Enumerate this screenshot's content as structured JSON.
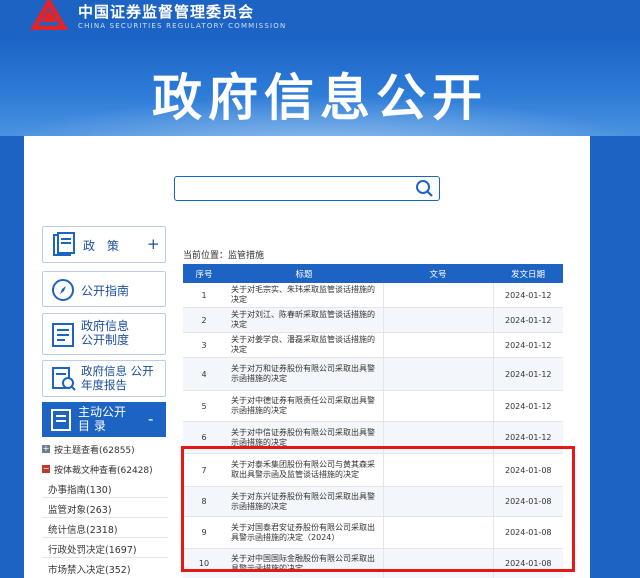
{
  "header": {
    "org_name_cn": "中国证券监督管理委员会",
    "org_name_en": "CHINA SECURITIES REGULATORY COMMISSION",
    "banner_title": "政府信息公开"
  },
  "search": {
    "placeholder": ""
  },
  "sidebar": {
    "buttons": [
      {
        "label": "政  策",
        "suffix": "+"
      },
      {
        "label": "公开指南"
      },
      {
        "label": "政府信息 公开制度"
      },
      {
        "label": "政府信息 公开年度报告"
      }
    ],
    "active": {
      "label": "主动公开 目  录",
      "suffix": "-"
    },
    "tree": [
      {
        "label": "按主题查看(62855)",
        "expanded": false
      },
      {
        "label": "按体裁文种查看(62428)",
        "expanded": true
      }
    ],
    "leaves": [
      "办事指南(130)",
      "监管对象(263)",
      "统计信息(2318)",
      "行政处罚决定(1697)",
      "市场禁入决定(352)"
    ]
  },
  "breadcrumb": "当前位置：监管措施",
  "table": {
    "headers": [
      "序号",
      "标题",
      "文号",
      "发文日期"
    ],
    "rows": [
      {
        "no": "1",
        "title": "关于对毛宗实、朱玮采取监管谈话措施的决定",
        "doc": "",
        "date": "2024-01-12"
      },
      {
        "no": "2",
        "title": "关于对刘江、陈春昕采取监管谈话措施的决定",
        "doc": "",
        "date": "2024-01-12"
      },
      {
        "no": "3",
        "title": "关于对姜学良、潘磊采取监管谈话措施的决定",
        "doc": "",
        "date": "2024-01-12"
      },
      {
        "no": "4",
        "title": "关于对万和证券股份有限公司采取出具警示函措施的决定",
        "doc": "",
        "date": "2024-01-12"
      },
      {
        "no": "5",
        "title": "关于对中德证券有限责任公司采取出具警示函措施的决定",
        "doc": "",
        "date": "2024-01-12"
      },
      {
        "no": "6",
        "title": "关于对中信证券股份有限公司采取出具警示函措施的决定",
        "doc": "",
        "date": "2024-01-12"
      },
      {
        "no": "7",
        "title": "关于对泰禾集团股份有限公司与黄其森采取出具警示函及监管谈话措施的决定",
        "doc": "",
        "date": "2024-01-08"
      },
      {
        "no": "8",
        "title": "关于对东兴证券股份有限公司采取出具警示函措施的决定",
        "doc": "",
        "date": "2024-01-08"
      },
      {
        "no": "9",
        "title": "关于对国泰君安证券股份有限公司采取出具警示函措施的决定（2024）",
        "doc": "",
        "date": "2024-01-08"
      },
      {
        "no": "10",
        "title": "关于对中国国际金融股份有限公司采取出具警示函措施的决定",
        "doc": "",
        "date": "2024-01-08"
      }
    ]
  },
  "colors": {
    "brand": "#1c63c4",
    "highlight": "#e51818"
  }
}
